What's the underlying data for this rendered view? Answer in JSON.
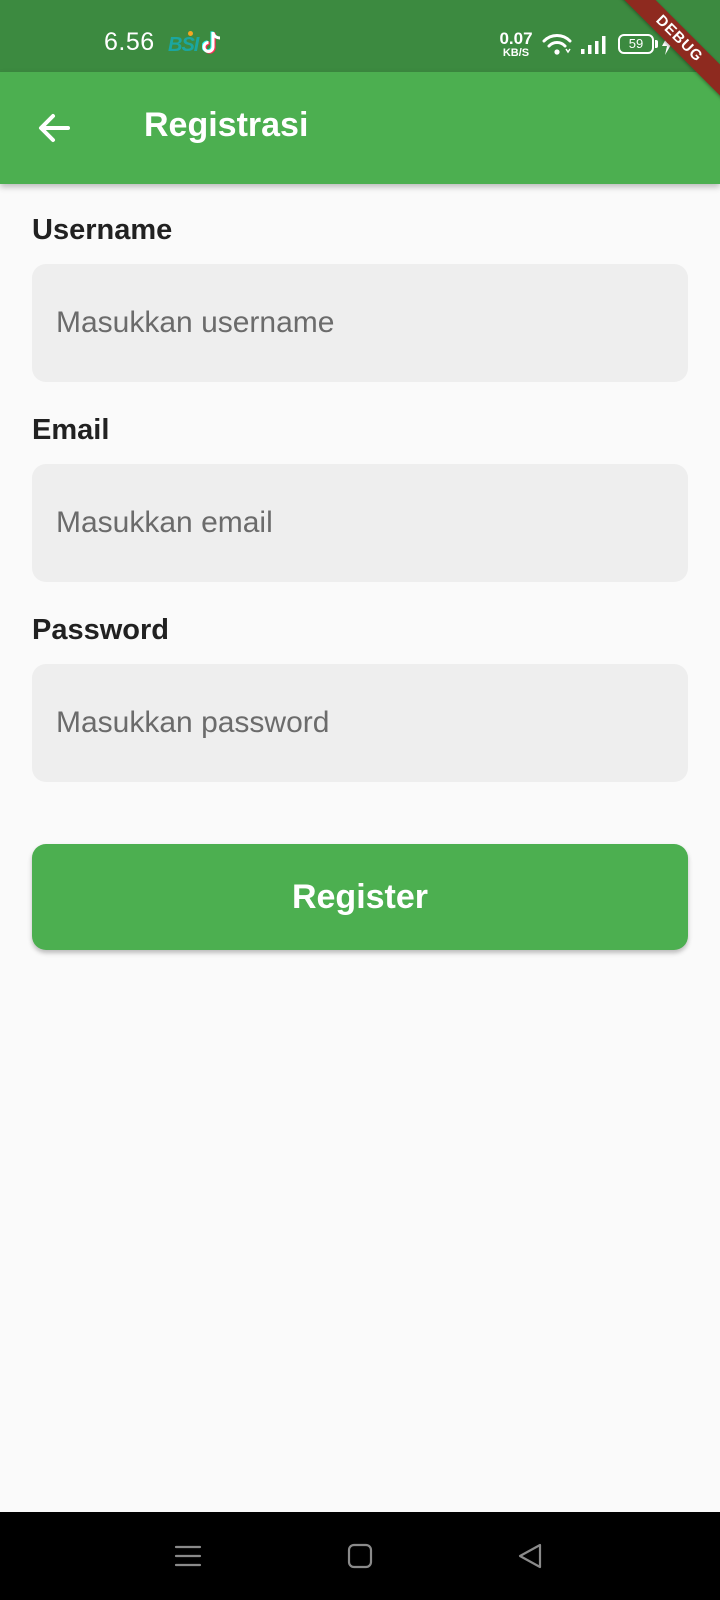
{
  "status_bar": {
    "time": "6.56",
    "bsi_label": "BSI",
    "net_speed_value": "0.07",
    "net_speed_unit": "KB/S",
    "battery_level": "59",
    "icons": [
      "bsi-app-icon",
      "tiktok-icon",
      "wifi-icon",
      "signal-icon",
      "battery-icon",
      "charging-icon"
    ]
  },
  "debug_banner": "DEBUG",
  "app_bar": {
    "title": "Registrasi",
    "back_icon": "arrow-left-icon",
    "color": "#4caf50"
  },
  "form": {
    "username": {
      "label": "Username",
      "placeholder": "Masukkan username",
      "value": ""
    },
    "email": {
      "label": "Email",
      "placeholder": "Masukkan email",
      "value": ""
    },
    "password": {
      "label": "Password",
      "placeholder": "Masukkan password",
      "value": ""
    },
    "submit_label": "Register"
  },
  "nav_bar": {
    "icons": [
      "menu-icon",
      "home-icon",
      "back-triangle-icon"
    ]
  },
  "colors": {
    "primary": "#4caf50",
    "status_bar": "#3c8a40",
    "input_background": "#eeeeee",
    "page_background": "#fafafa",
    "debug_ribbon": "#8e2a1f"
  }
}
